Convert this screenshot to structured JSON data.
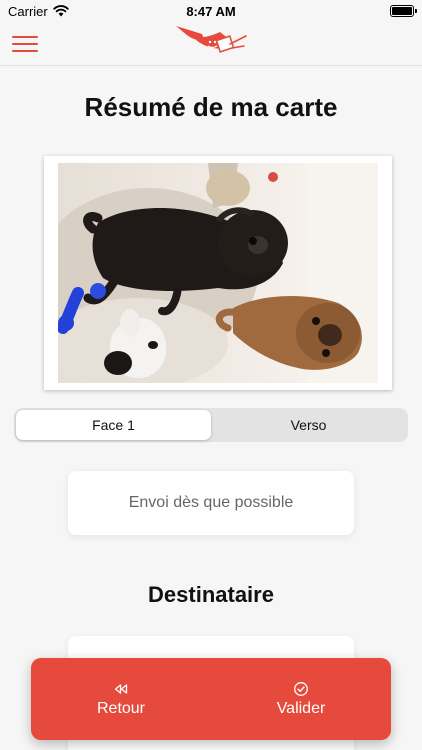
{
  "status_bar": {
    "carrier": "Carrier",
    "time": "8:47 AM",
    "battery_level": 1.0
  },
  "nav": {
    "menu_icon": "hamburger-menu-icon",
    "logo_icon": "flying-postcard-logo"
  },
  "page": {
    "title": "Résumé de ma carte"
  },
  "card_preview": {
    "image": "photo-two-dogs"
  },
  "tabs": {
    "items": [
      {
        "label": "Face 1",
        "selected": true
      },
      {
        "label": "Verso",
        "selected": false
      }
    ]
  },
  "send": {
    "option_label": "Envoi dès que possible"
  },
  "recipient": {
    "section_title": "Destinataire"
  },
  "actions": {
    "back_label": "Retour",
    "back_icon": "rewind-icon",
    "validate_label": "Valider",
    "validate_icon": "check-circle-icon"
  },
  "colors": {
    "accent": "#e64a3d",
    "background": "#f6f6f6"
  }
}
